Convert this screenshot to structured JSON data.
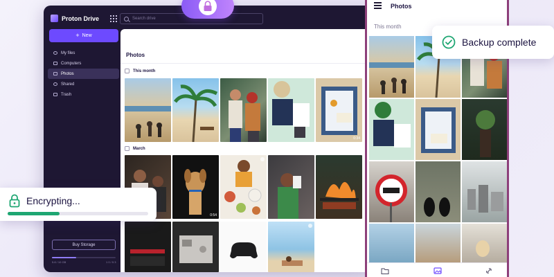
{
  "desktop": {
    "logo_text": "Proton Drive",
    "search_placeholder": "Search drive",
    "new_button": "New",
    "nav": [
      {
        "label": "My files",
        "active": false
      },
      {
        "label": "Computers",
        "active": false
      },
      {
        "label": "Photos",
        "active": true
      },
      {
        "label": "Shared",
        "active": false
      },
      {
        "label": "Trash",
        "active": false
      }
    ],
    "buy_storage": "Buy Storage",
    "storage_used": "5.8 / 10 GB",
    "storage_total": "1 0 / 5 3",
    "storage_fraction": 0.38,
    "main_title": "Photos",
    "sections": [
      {
        "label": "This month",
        "video_durations": [
          "0:34"
        ]
      },
      {
        "label": "March",
        "video_durations": [
          "0:54"
        ]
      }
    ]
  },
  "phone": {
    "title": "Photos",
    "section": "This month",
    "tab_icons": [
      "folder-icon",
      "photos-icon",
      "link-icon"
    ]
  },
  "toasts": {
    "backup": "Backup complete",
    "encrypting": "Encrypting...",
    "encrypting_progress": 0.37
  },
  "colors": {
    "brand_purple": "#6d4aff",
    "sidebar_bg": "#1e1733",
    "success_green": "#1ea672"
  },
  "icons": [
    "lock-icon",
    "check-circle-icon",
    "search-icon",
    "apps-grid-icon",
    "menu-icon"
  ]
}
